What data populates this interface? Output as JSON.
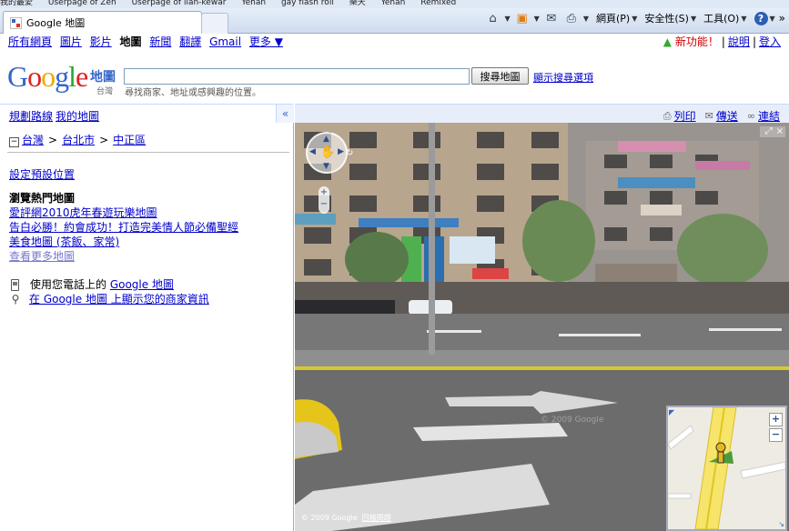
{
  "browser": {
    "favorites_bar": [
      "我的最愛",
      "Userpage of Zen",
      "Userpage of lian-kewar",
      "Yehan",
      "gay flash roll",
      "樂天",
      "Yehan",
      "Remixed"
    ],
    "tab_title": "Google 地圖",
    "command_bar": {
      "page_menu": "網頁(P)",
      "safety_menu": "安全性(S)",
      "tools_menu": "工具(O)",
      "overflow": "»"
    }
  },
  "gnav": {
    "items": [
      "所有網頁",
      "圖片",
      "影片",
      "地圖",
      "新聞",
      "翻譯",
      "Gmail",
      "更多 ▼"
    ],
    "current": "地圖",
    "new_feature": "新功能！",
    "help": "說明",
    "signin": "登入"
  },
  "search": {
    "logo_text": "Google",
    "logo_maps": "地圖",
    "logo_region": "台灣",
    "value": "",
    "button": "搜尋地圖",
    "options_link": "顯示搜尋選項",
    "hint": "尋找商家、地址或感興趣的位置。"
  },
  "left_panel": {
    "header_links": [
      "規劃路線",
      "我的地圖"
    ],
    "collapse_label": "«",
    "breadcrumb": [
      "台灣",
      "台北市",
      "中正區"
    ],
    "set_default": "設定預設位置",
    "popular_title": "瀏覽熱門地圖",
    "popular_maps": [
      "愛評網2010虎年春遊玩樂地圖",
      "告白必勝！約會成功！打造完美情人節必備聖經",
      "美食地圖 (茶飯、家常)"
    ],
    "more_maps": "查看更多地圖",
    "promo_phone_prefix": "使用您電話上的 ",
    "promo_phone_link": "Google 地圖",
    "promo_business": "在 Google 地圖 上顯示您的商家資訊"
  },
  "map_panel": {
    "actions": [
      "列印",
      "傳送",
      "連結"
    ],
    "copyright": "© 2009 Google",
    "terms": "回報問題",
    "watermark": "© 2009 Google",
    "close_label": "×"
  },
  "icons": {
    "home": "home-icon",
    "feeds": "rss-icon",
    "mail": "mail-icon",
    "print": "printer-icon",
    "help": "help-icon"
  },
  "colors": {
    "link": "#0000cc",
    "new_feature": "#cc0000",
    "map_header_bg": "#e8eef9"
  }
}
